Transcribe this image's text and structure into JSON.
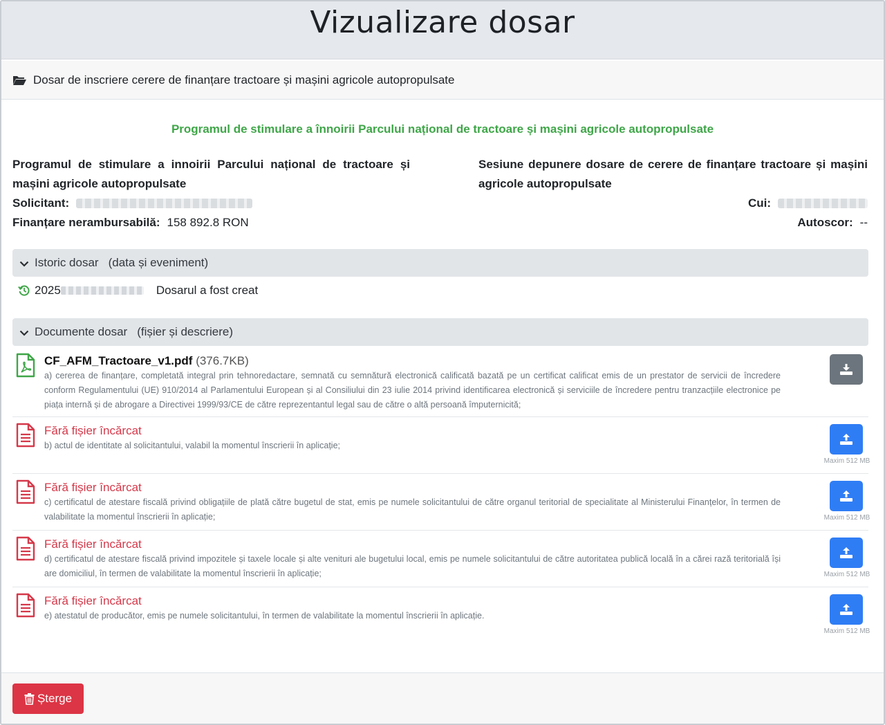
{
  "page": {
    "title": "Vizualizare dosar"
  },
  "card": {
    "header": "Dosar de inscriere cerere de finanțare tractoare și mașini agricole autopropulsate"
  },
  "program": {
    "title": "Programul de stimulare a înnoirii Parcului național de tractoare și mașini agricole autopropulsate"
  },
  "info": {
    "left_title": "Programul de stimulare a innoirii Parcului național de tractoare și mașini agricole autopropulsate",
    "right_title": "Sesiune depunere dosare de cerere de finanțare tractoare și mașini agricole autopropulsate",
    "solicitant_label": "Solicitant:",
    "finantare_label": "Finanțare nerambursabilă:",
    "finantare_value": "158 892.8 RON",
    "cui_label": "Cui:",
    "autoscor_label": "Autoscor:",
    "autoscor_value": "--"
  },
  "history": {
    "title": "Istoric dosar",
    "subtitle": "(data și eveniment)",
    "entries": [
      {
        "date_prefix": "2025",
        "event": "Dosarul a fost creat"
      }
    ]
  },
  "documents": {
    "title": "Documente dosar",
    "subtitle": "(fișier și descriere)",
    "max_note": "Maxim 512 MB",
    "items": [
      {
        "name": "CF_AFM_Tractoare_v1.pdf",
        "size": "(376.7KB)",
        "description": "a) cererea de finanțare, completată integral prin tehnoredactare, semnată cu semnătură electronică calificată bazată pe un certificat calificat emis de un prestator de servicii de încredere conform Regulamentului (UE) 910/2014 al Parlamentului European și al Consiliului din 23 iulie 2014 privind identificarea electronică și serviciile de încredere pentru tranzacțiile electronice pe piața internă și de abrogare a Directivei 1999/93/CE de către reprezentantul legal sau de către o altă persoană împuternicită;"
      },
      {
        "name": "Fără fișier încărcat",
        "description": "b) actul de identitate al solicitantului, valabil la momentul înscrierii în aplicație;"
      },
      {
        "name": "Fără fișier încărcat",
        "description": "c) certificatul de atestare fiscală privind obligațiile de plată către bugetul de stat, emis pe numele solicitantului de către organul teritorial de specialitate al Ministerului Finanțelor, în termen de valabilitate la momentul înscrierii în aplicație;"
      },
      {
        "name": "Fără fișier încărcat",
        "description": "d) certificatul de atestare fiscală privind impozitele și taxele locale și alte venituri ale bugetului local, emis pe numele solicitantului de către autoritatea publică locală în a cărei rază teritorială își are domiciliul, în termen de valabilitate la momentul înscrierii în aplicație;"
      },
      {
        "name": "Fără fișier încărcat",
        "description": "e) atestatul de producător, emis pe numele solicitantului, în termen de valabilitate la momentul înscrierii în aplicație."
      }
    ]
  },
  "footer": {
    "delete_label": "Șterge"
  },
  "colors": {
    "green": "#3fa648",
    "red": "#dc3545",
    "blue": "#2f7df5",
    "gray": "#6c757d"
  },
  "icons": [
    "folder-open-icon",
    "chevron-down-icon",
    "history-icon",
    "file-pdf-icon",
    "file-icon",
    "download-icon",
    "upload-icon",
    "trash-icon"
  ]
}
